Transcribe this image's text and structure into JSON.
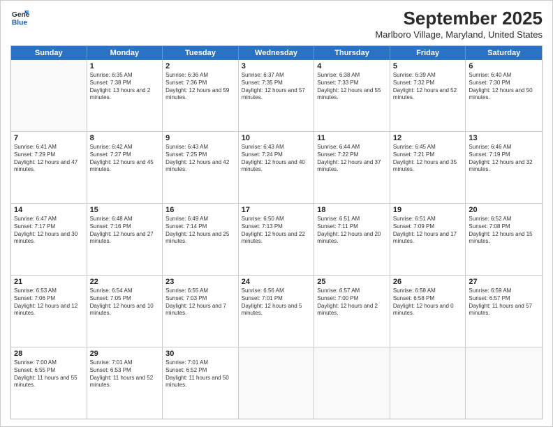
{
  "logo": {
    "line1": "General",
    "line2": "Blue"
  },
  "title": "September 2025",
  "location": "Marlboro Village, Maryland, United States",
  "weekdays": [
    "Sunday",
    "Monday",
    "Tuesday",
    "Wednesday",
    "Thursday",
    "Friday",
    "Saturday"
  ],
  "weeks": [
    [
      {
        "day": "",
        "sunrise": "",
        "sunset": "",
        "daylight": ""
      },
      {
        "day": "1",
        "sunrise": "Sunrise: 6:35 AM",
        "sunset": "Sunset: 7:38 PM",
        "daylight": "Daylight: 13 hours and 2 minutes."
      },
      {
        "day": "2",
        "sunrise": "Sunrise: 6:36 AM",
        "sunset": "Sunset: 7:36 PM",
        "daylight": "Daylight: 12 hours and 59 minutes."
      },
      {
        "day": "3",
        "sunrise": "Sunrise: 6:37 AM",
        "sunset": "Sunset: 7:35 PM",
        "daylight": "Daylight: 12 hours and 57 minutes."
      },
      {
        "day": "4",
        "sunrise": "Sunrise: 6:38 AM",
        "sunset": "Sunset: 7:33 PM",
        "daylight": "Daylight: 12 hours and 55 minutes."
      },
      {
        "day": "5",
        "sunrise": "Sunrise: 6:39 AM",
        "sunset": "Sunset: 7:32 PM",
        "daylight": "Daylight: 12 hours and 52 minutes."
      },
      {
        "day": "6",
        "sunrise": "Sunrise: 6:40 AM",
        "sunset": "Sunset: 7:30 PM",
        "daylight": "Daylight: 12 hours and 50 minutes."
      }
    ],
    [
      {
        "day": "7",
        "sunrise": "Sunrise: 6:41 AM",
        "sunset": "Sunset: 7:29 PM",
        "daylight": "Daylight: 12 hours and 47 minutes."
      },
      {
        "day": "8",
        "sunrise": "Sunrise: 6:42 AM",
        "sunset": "Sunset: 7:27 PM",
        "daylight": "Daylight: 12 hours and 45 minutes."
      },
      {
        "day": "9",
        "sunrise": "Sunrise: 6:43 AM",
        "sunset": "Sunset: 7:25 PM",
        "daylight": "Daylight: 12 hours and 42 minutes."
      },
      {
        "day": "10",
        "sunrise": "Sunrise: 6:43 AM",
        "sunset": "Sunset: 7:24 PM",
        "daylight": "Daylight: 12 hours and 40 minutes."
      },
      {
        "day": "11",
        "sunrise": "Sunrise: 6:44 AM",
        "sunset": "Sunset: 7:22 PM",
        "daylight": "Daylight: 12 hours and 37 minutes."
      },
      {
        "day": "12",
        "sunrise": "Sunrise: 6:45 AM",
        "sunset": "Sunset: 7:21 PM",
        "daylight": "Daylight: 12 hours and 35 minutes."
      },
      {
        "day": "13",
        "sunrise": "Sunrise: 6:46 AM",
        "sunset": "Sunset: 7:19 PM",
        "daylight": "Daylight: 12 hours and 32 minutes."
      }
    ],
    [
      {
        "day": "14",
        "sunrise": "Sunrise: 6:47 AM",
        "sunset": "Sunset: 7:17 PM",
        "daylight": "Daylight: 12 hours and 30 minutes."
      },
      {
        "day": "15",
        "sunrise": "Sunrise: 6:48 AM",
        "sunset": "Sunset: 7:16 PM",
        "daylight": "Daylight: 12 hours and 27 minutes."
      },
      {
        "day": "16",
        "sunrise": "Sunrise: 6:49 AM",
        "sunset": "Sunset: 7:14 PM",
        "daylight": "Daylight: 12 hours and 25 minutes."
      },
      {
        "day": "17",
        "sunrise": "Sunrise: 6:50 AM",
        "sunset": "Sunset: 7:13 PM",
        "daylight": "Daylight: 12 hours and 22 minutes."
      },
      {
        "day": "18",
        "sunrise": "Sunrise: 6:51 AM",
        "sunset": "Sunset: 7:11 PM",
        "daylight": "Daylight: 12 hours and 20 minutes."
      },
      {
        "day": "19",
        "sunrise": "Sunrise: 6:51 AM",
        "sunset": "Sunset: 7:09 PM",
        "daylight": "Daylight: 12 hours and 17 minutes."
      },
      {
        "day": "20",
        "sunrise": "Sunrise: 6:52 AM",
        "sunset": "Sunset: 7:08 PM",
        "daylight": "Daylight: 12 hours and 15 minutes."
      }
    ],
    [
      {
        "day": "21",
        "sunrise": "Sunrise: 6:53 AM",
        "sunset": "Sunset: 7:06 PM",
        "daylight": "Daylight: 12 hours and 12 minutes."
      },
      {
        "day": "22",
        "sunrise": "Sunrise: 6:54 AM",
        "sunset": "Sunset: 7:05 PM",
        "daylight": "Daylight: 12 hours and 10 minutes."
      },
      {
        "day": "23",
        "sunrise": "Sunrise: 6:55 AM",
        "sunset": "Sunset: 7:03 PM",
        "daylight": "Daylight: 12 hours and 7 minutes."
      },
      {
        "day": "24",
        "sunrise": "Sunrise: 6:56 AM",
        "sunset": "Sunset: 7:01 PM",
        "daylight": "Daylight: 12 hours and 5 minutes."
      },
      {
        "day": "25",
        "sunrise": "Sunrise: 6:57 AM",
        "sunset": "Sunset: 7:00 PM",
        "daylight": "Daylight: 12 hours and 2 minutes."
      },
      {
        "day": "26",
        "sunrise": "Sunrise: 6:58 AM",
        "sunset": "Sunset: 6:58 PM",
        "daylight": "Daylight: 12 hours and 0 minutes."
      },
      {
        "day": "27",
        "sunrise": "Sunrise: 6:59 AM",
        "sunset": "Sunset: 6:57 PM",
        "daylight": "Daylight: 11 hours and 57 minutes."
      }
    ],
    [
      {
        "day": "28",
        "sunrise": "Sunrise: 7:00 AM",
        "sunset": "Sunset: 6:55 PM",
        "daylight": "Daylight: 11 hours and 55 minutes."
      },
      {
        "day": "29",
        "sunrise": "Sunrise: 7:01 AM",
        "sunset": "Sunset: 6:53 PM",
        "daylight": "Daylight: 11 hours and 52 minutes."
      },
      {
        "day": "30",
        "sunrise": "Sunrise: 7:01 AM",
        "sunset": "Sunset: 6:52 PM",
        "daylight": "Daylight: 11 hours and 50 minutes."
      },
      {
        "day": "",
        "sunrise": "",
        "sunset": "",
        "daylight": ""
      },
      {
        "day": "",
        "sunrise": "",
        "sunset": "",
        "daylight": ""
      },
      {
        "day": "",
        "sunrise": "",
        "sunset": "",
        "daylight": ""
      },
      {
        "day": "",
        "sunrise": "",
        "sunset": "",
        "daylight": ""
      }
    ]
  ]
}
